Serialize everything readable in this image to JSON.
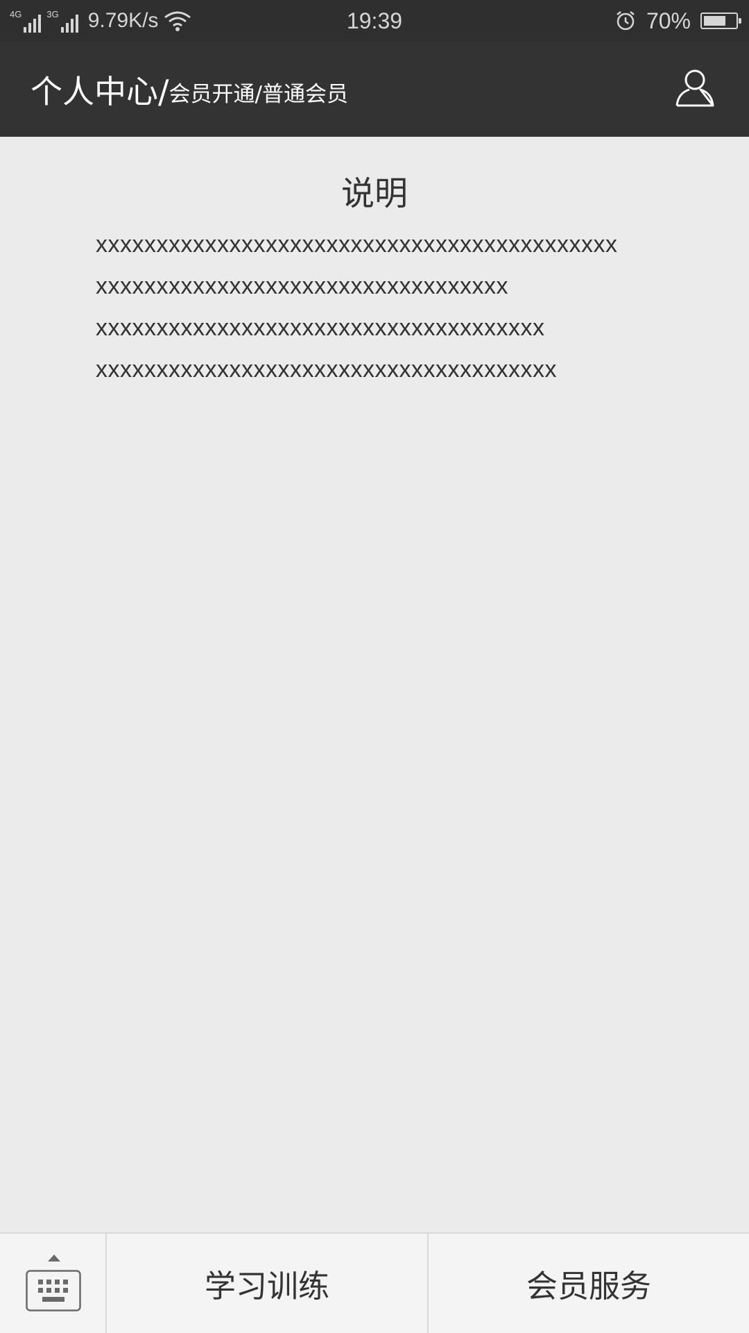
{
  "status_bar": {
    "network1": "4G",
    "network2": "3G",
    "speed": "9.79K/s",
    "time": "19:39",
    "battery_text": "70%",
    "battery_level": 0.7,
    "icons": [
      "signal-icon",
      "wifi-icon",
      "alarm-icon",
      "battery-icon"
    ]
  },
  "header": {
    "title_main": "个人中心/",
    "title_sub": "会员开通/普通会员",
    "user_icon": "user-icon"
  },
  "content": {
    "title": "说明",
    "lines": [
      "xxxxxxxxxxxxxxxxxxxxxxxxxxxxxxxxxxxxxxxxxxx",
      "xxxxxxxxxxxxxxxxxxxxxxxxxxxxxxxxxx",
      "xxxxxxxxxxxxxxxxxxxxxxxxxxxxxxxxxxxxx",
      "xxxxxxxxxxxxxxxxxxxxxxxxxxxxxxxxxxxxxx"
    ]
  },
  "bottom_bar": {
    "keyboard_icon": "keyboard-icon",
    "tabs": [
      {
        "label": "学习训练"
      },
      {
        "label": "会员服务"
      }
    ]
  },
  "colors": {
    "header_bg": "#333333",
    "status_bg": "#2f2f2f",
    "page_bg": "#ebebeb",
    "bottom_bg": "#f4f4f4"
  }
}
